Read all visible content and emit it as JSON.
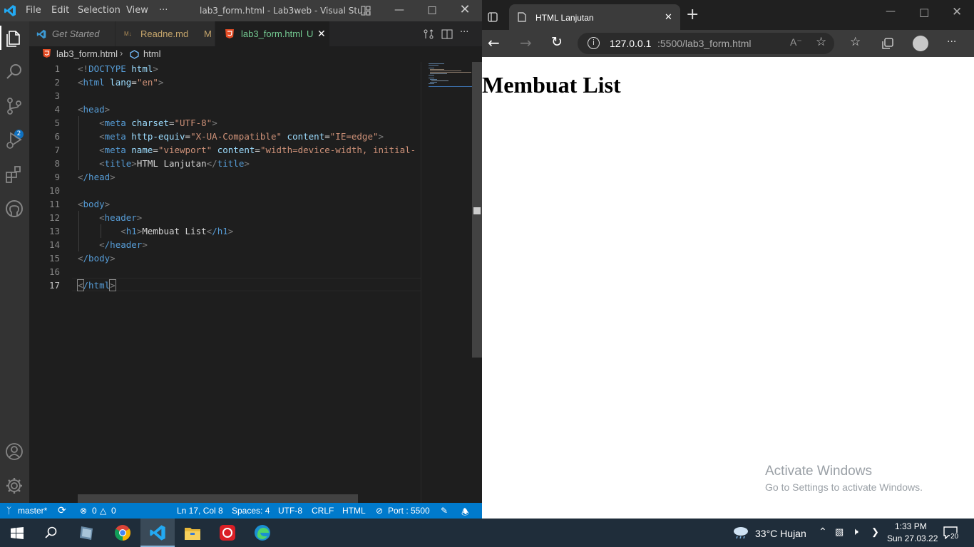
{
  "vscode": {
    "menu": [
      "File",
      "Edit",
      "Selection",
      "View",
      "···"
    ],
    "window_title": "lab3_form.html - Lab3web - Visual Stu...",
    "source_control_badge": "2",
    "tabs": [
      {
        "label": "Get Started",
        "status": ""
      },
      {
        "label": "Readne.md",
        "status": "M"
      },
      {
        "label": "lab3_form.html",
        "status": "U"
      }
    ],
    "breadcrumb": {
      "file": "lab3_form.html",
      "symbol": "html"
    },
    "code_lines": [
      {
        "n": "1"
      },
      {
        "n": "2"
      },
      {
        "n": "3"
      },
      {
        "n": "4"
      },
      {
        "n": "5"
      },
      {
        "n": "6"
      },
      {
        "n": "7"
      },
      {
        "n": "8"
      },
      {
        "n": "9"
      },
      {
        "n": "10"
      },
      {
        "n": "11"
      },
      {
        "n": "12"
      },
      {
        "n": "13"
      },
      {
        "n": "14"
      },
      {
        "n": "15"
      },
      {
        "n": "16"
      },
      {
        "n": "17"
      }
    ],
    "code": {
      "l1a": "<!",
      "l1b": "DOCTYPE",
      "l1c": " html",
      "l1d": ">",
      "l2tag": "html",
      "l2attr": "lang",
      "l2val": "\"en\"",
      "l4tag": "head",
      "l5tag": "meta",
      "l5attr": "charset",
      "l5val": "\"UTF-8\"",
      "l6tag": "meta",
      "l6attr1": "http-equiv",
      "l6val1": "\"X-UA-Compatible\"",
      "l6attr2": "content",
      "l6val2": "\"IE=edge\"",
      "l7tag": "meta",
      "l7attr1": "name",
      "l7val1": "\"viewport\"",
      "l7attr2": "content",
      "l7val2": "\"width=device-width, initial-",
      "l8tag": "title",
      "l8text": "HTML Lanjutan",
      "l9tag": "/head",
      "l11tag": "body",
      "l12tag": "header",
      "l13tag": "h1",
      "l13text": "Membuat List",
      "l13close": "/h1",
      "l14tag": "/header",
      "l15tag": "/body",
      "l17tag": "/html"
    },
    "status": {
      "branch": "master*",
      "errors": "0",
      "warnings": "0",
      "position": "Ln 17, Col 8",
      "spaces": "Spaces: 4",
      "encoding": "UTF-8",
      "eol": "CRLF",
      "language": "HTML",
      "port": "Port : 5500"
    }
  },
  "browser": {
    "tab_title": "HTML Lanjutan",
    "url_host": "127.0.0.1",
    "url_rest": ":5500/lab3_form.html",
    "page_heading": "Membuat List",
    "watermark_title": "Activate Windows",
    "watermark_sub": "Go to Settings to activate Windows."
  },
  "taskbar": {
    "weather": "33°C  Hujan",
    "time": "1:33 PM",
    "date": "Sun 27.03.22",
    "notifications": "20"
  },
  "colors": {
    "vscode_accent": "#007acc",
    "activity_bar": "#333333",
    "editor_bg": "#1e1e1e",
    "edge_toolbar": "#3b3b3b",
    "taskbar": "#1f2d3a"
  }
}
